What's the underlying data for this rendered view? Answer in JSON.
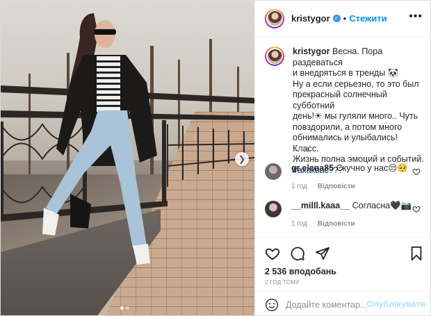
{
  "post": {
    "username": "kristygor",
    "follow_label": "Стежити",
    "separator": "•",
    "more_label": "•••",
    "caption_lines": [
      "Весна. Пора раздеваться",
      "и внедряться в тренды 🐼",
      "Ну а если серьезно, то это был",
      "прекрасный солнечный субботний",
      "день!☀ мы гуляли много.. Чуть",
      "повздорили, а потом много",
      "обнимались и улыбались! Класс.",
      "Жизнь полна эмоций и событий."
    ],
    "hashtag": "#акаквас",
    "caption_suffix": "???",
    "time": "2 год.",
    "likes": "2 536 вподобань",
    "ago": "2 ГОД ТОМУ"
  },
  "comments": [
    {
      "username": "gr.elena85",
      "text": "Скучно у нас😒🥺",
      "time": "1 год",
      "reply_label": "Відповісти"
    },
    {
      "username": "__milll.kaaa__",
      "text": "Согласна🖤📷",
      "time": "1 год",
      "reply_label": "Відповісти"
    }
  ],
  "composer": {
    "placeholder": "Додайте коментар...",
    "publish_label": "Опублікувати"
  },
  "colors": {
    "accent": "#0095f6",
    "publish_disabled": "#b2dffc",
    "verified": "#3897f0",
    "hashtag": "#00376b"
  },
  "icons": [
    "verified-badge-icon",
    "more-options-icon",
    "next-arrow-icon",
    "heart-icon",
    "comment-icon",
    "share-icon",
    "bookmark-icon",
    "emoji-icon",
    "heart-small-icon"
  ]
}
